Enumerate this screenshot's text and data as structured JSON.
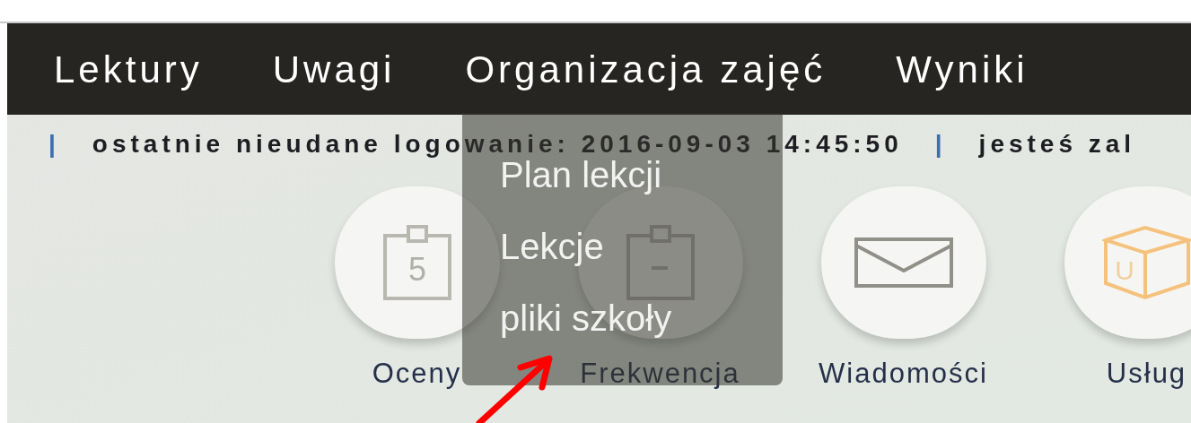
{
  "nav": [
    "Lektury",
    "Uwagi",
    "Organizacja zajęć",
    "Wyniki"
  ],
  "status_line": {
    "separators": [
      "|",
      "|"
    ],
    "last_failed_login": "ostatnie nieudane logowanie: 2016-09-03 14:45:50",
    "logged_in": "jesteś zal"
  },
  "tiles": [
    {
      "kind": "grade",
      "label": "Oceny",
      "icon_text": "5"
    },
    {
      "kind": "attendance",
      "label": "Frekwencja"
    },
    {
      "kind": "mail",
      "label": "Wiadomości"
    },
    {
      "kind": "box",
      "label": "Usług",
      "icon_text": "U"
    }
  ],
  "dropdown": [
    "Plan lekcji",
    "Lekcje",
    "pliki szkoły"
  ]
}
